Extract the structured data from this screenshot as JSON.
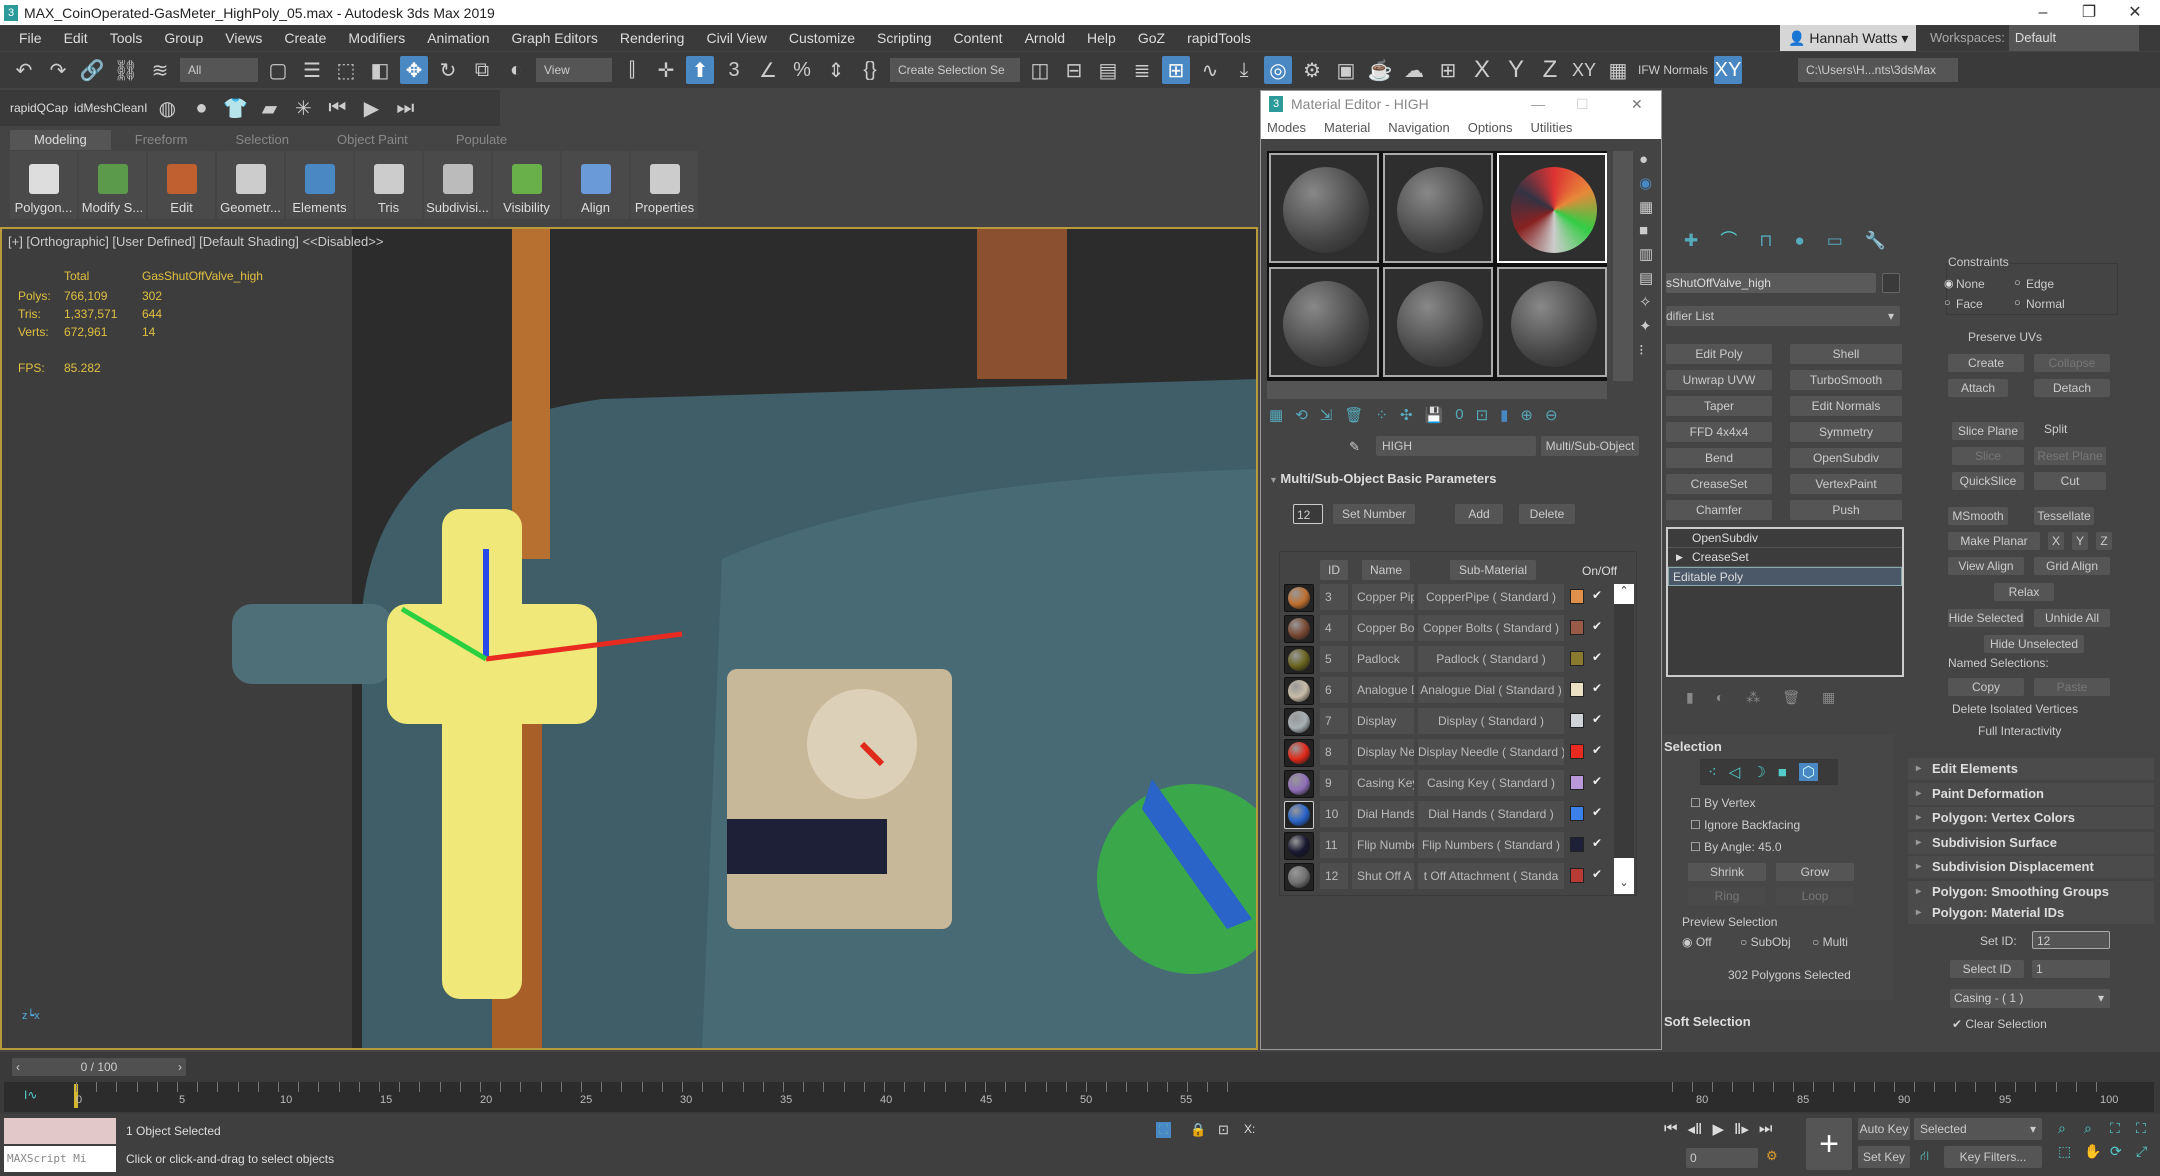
{
  "window": {
    "title": "MAX_CoinOperated-GasMeter_HighPoly_05.max - Autodesk 3ds Max 2019",
    "logo": "3"
  },
  "menu": [
    "File",
    "Edit",
    "Tools",
    "Group",
    "Views",
    "Create",
    "Modifiers",
    "Animation",
    "Graph Editors",
    "Rendering",
    "Civil View",
    "Customize",
    "Scripting",
    "Content",
    "Arnold",
    "Help",
    "GoZ",
    "rapidTools"
  ],
  "user": {
    "name": "Hannah Watts ▾",
    "workspaces_label": "Workspaces:",
    "workspace": "Default"
  },
  "toolbar": {
    "filter": "All",
    "ref_coord": "View",
    "selection_set": "Create Selection Se",
    "xyz": [
      "X",
      "Y",
      "Z",
      "XY"
    ],
    "ifw": "IFW Normals",
    "path": "C:\\Users\\H...nts\\3dsMax"
  },
  "toolbar2": {
    "labels": [
      "rapidQCap",
      "idMeshCleanI"
    ]
  },
  "ribbon": {
    "tabs": [
      "Modeling",
      "Freeform",
      "Selection",
      "Object Paint",
      "Populate"
    ],
    "active": "Modeling",
    "buttons": [
      "Polygon...",
      "Modify S...",
      "Edit",
      "Geometr...",
      "Elements",
      "Tris",
      "Subdivisi...",
      "Visibility",
      "Align",
      "Properties"
    ]
  },
  "viewport": {
    "label": "[+] [Orthographic] [User Defined] [Default Shading]  <<Disabled>>",
    "stats": {
      "col_total": "Total",
      "col_object": "GasShutOffValve_high",
      "rows": [
        {
          "label": "Polys:",
          "total": "766,109",
          "obj": "302"
        },
        {
          "label": "Tris:",
          "total": "1,337,571",
          "obj": "644"
        },
        {
          "label": "Verts:",
          "total": "672,961",
          "obj": "14"
        }
      ],
      "fps_label": "FPS:",
      "fps": "85.282"
    }
  },
  "material_editor": {
    "title": "Material Editor - HIGH",
    "menu": [
      "Modes",
      "Material",
      "Navigation",
      "Options",
      "Utilities"
    ],
    "material_name": "HIGH",
    "material_type": "Multi/Sub-Object",
    "rollout": "Multi/Sub-Object Basic Parameters",
    "count": "12",
    "set_number": "Set Number",
    "add": "Add",
    "delete": "Delete",
    "headers": {
      "id": "ID",
      "name": "Name",
      "sub": "Sub-Material",
      "onoff": "On/Off"
    },
    "rows": [
      {
        "id": "3",
        "name": "Copper Pip",
        "sub": "CopperPipe  ( Standard )",
        "color": "#e0904a",
        "sphere": "#c07030",
        "on": true
      },
      {
        "id": "4",
        "name": "Copper Bo",
        "sub": "Copper Bolts  ( Standard )",
        "color": "#9a5a48",
        "sphere": "#7a4a34",
        "on": true
      },
      {
        "id": "5",
        "name": "Padlock",
        "sub": "Padlock  ( Standard )",
        "color": "#8a7a30",
        "sphere": "#6a6420",
        "on": true
      },
      {
        "id": "6",
        "name": "Analogue D",
        "sub": "Analogue Dial  ( Standard )",
        "color": "#ece0c4",
        "sphere": "#c8bca8",
        "on": true
      },
      {
        "id": "7",
        "name": "Display",
        "sub": "Display  ( Standard )",
        "color": "#d0d4d8",
        "sphere": "#a8b0b4",
        "on": true
      },
      {
        "id": "8",
        "name": "Display Ne",
        "sub": "Display Needle  ( Standard )",
        "color": "#e82a20",
        "sphere": "#e02a1a",
        "on": true
      },
      {
        "id": "9",
        "name": "Casing Key",
        "sub": "Casing Key  ( Standard )",
        "color": "#b898d8",
        "sphere": "#9070b8",
        "on": true
      },
      {
        "id": "10",
        "name": "Dial Hands",
        "sub": "Dial Hands  ( Standard )",
        "color": "#3a80e8",
        "sphere": "#2a64c8",
        "on": true
      },
      {
        "id": "11",
        "name": "Flip Numbe",
        "sub": "Flip Numbers  ( Standard )",
        "color": "#1e2038",
        "sphere": "#181830",
        "on": true
      },
      {
        "id": "12",
        "name": "Shut Off A",
        "sub": "t Off Attachment  ( Standa",
        "color": "#b83a34",
        "sphere": "#707070",
        "on": true
      }
    ]
  },
  "command_panel": {
    "object_name": "sShutOffValve_high",
    "modifier_list": "difier List",
    "modifiers": [
      "Edit Poly",
      "Shell",
      "Unwrap UVW",
      "TurboSmooth",
      "Taper",
      "Edit Normals",
      "FFD 4x4x4",
      "Symmetry",
      "Bend",
      "OpenSubdiv",
      "CreaseSet",
      "VertexPaint",
      "Chamfer",
      "Push"
    ],
    "stack": [
      "OpenSubdiv",
      "CreaseSet",
      "Editable Poly"
    ],
    "selection": {
      "title": "Selection",
      "by_vertex": "By Vertex",
      "ignore_backfacing": "Ignore Backfacing",
      "by_angle": "By Angle:",
      "angle": "45.0",
      "shrink": "Shrink",
      "grow": "Grow",
      "ring": "Ring",
      "loop": "Loop",
      "preview": "Preview Selection",
      "off": "Off",
      "subobj": "SubObj",
      "multi": "Multi",
      "status": "302 Polygons Selected"
    },
    "soft_selection": "Soft Selection",
    "edit_geometry": {
      "constraints": "Constraints",
      "none": "None",
      "edge": "Edge",
      "face": "Face",
      "normal": "Normal",
      "preserve_uvs": "Preserve UVs",
      "create": "Create",
      "collapse": "Collapse",
      "attach": "Attach",
      "detach": "Detach",
      "slice_plane": "Slice Plane",
      "split": "Split",
      "slice": "Slice",
      "reset_plane": "Reset Plane",
      "quickslice": "QuickSlice",
      "cut": "Cut",
      "msmooth": "MSmooth",
      "tessellate": "Tessellate",
      "make_planar": "Make Planar",
      "x": "X",
      "y": "Y",
      "z": "Z",
      "view_align": "View Align",
      "grid_align": "Grid Align",
      "relax": "Relax",
      "hide_selected": "Hide Selected",
      "unhide_all": "Unhide All",
      "hide_unselected": "Hide Unselected",
      "named_selections": "Named Selections:",
      "copy": "Copy",
      "paste": "Paste",
      "delete_isolated": "Delete Isolated Vertices",
      "full_interactivity": "Full Interactivity"
    },
    "rollouts": [
      "Edit Elements",
      "Paint Deformation",
      "Polygon: Vertex Colors",
      "Subdivision Surface",
      "Subdivision Displacement",
      "Polygon: Smoothing Groups"
    ],
    "material_ids": {
      "title": "Polygon: Material IDs",
      "set_id_label": "Set ID:",
      "set_id": "12",
      "select_id": "Select ID",
      "select_value": "1",
      "dropdown": "Casing - ( 1 )",
      "clear_selection": "Clear Selection"
    }
  },
  "timeline": {
    "frame": "0 / 100",
    "ticks": [
      "0",
      "5",
      "10",
      "15",
      "20",
      "25",
      "30",
      "35",
      "40",
      "45",
      "50",
      "55",
      "",
      "80",
      "85",
      "90",
      "95",
      "100"
    ],
    "current_frame": 0
  },
  "status": {
    "selected": "1 Object Selected",
    "prompt": "Click or click-and-drag to select objects",
    "maxscript": "MAXScript Mi",
    "auto_key": "Auto Key",
    "set_key": "Set Key",
    "key_mode": "Selected",
    "key_filters": "Key Filters...",
    "frame": "0",
    "x_label": "X:"
  },
  "colors": {
    "accent": "#4a88c4",
    "viewport_border": "#b89a3a",
    "stats_text": "#e0c040",
    "valve": "#f0e878",
    "casing": "#3f5e68"
  }
}
